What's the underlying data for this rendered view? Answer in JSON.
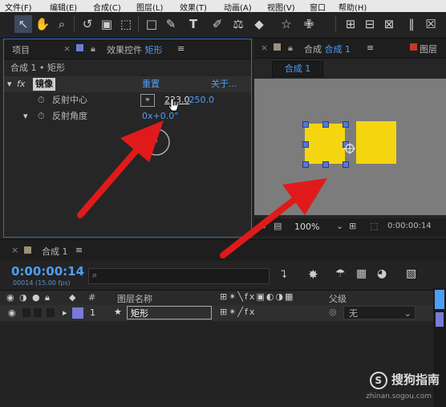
{
  "menu": [
    "文件(F)",
    "编辑(E)",
    "合成(C)",
    "图层(L)",
    "效果(T)",
    "动画(A)",
    "视图(V)",
    "窗口",
    "帮助(H)"
  ],
  "tools": [
    "selection-icon",
    "hand-icon",
    "zoom-icon",
    "rotate-icon",
    "camera-icon",
    "pan-behind-icon",
    "rectangle-icon",
    "pen-icon",
    "type-icon",
    "brush-icon",
    "clone-stamp-icon",
    "eraser-icon",
    "roto-brush-icon",
    "puppet-pin-icon"
  ],
  "left_panel": {
    "tab_project": "项目",
    "tab_effects_prefix": "效果控件",
    "tab_effects_layer": "矩形",
    "breadcrumb": "合成 1 • 矩形",
    "effect_name": "镜像",
    "reset_label": "重置",
    "about_label": "关于...",
    "prop1_label": "反射中心",
    "prop1_x": "223.0",
    "prop1_y": ",250.0",
    "prop2_label": "反射角度",
    "prop2_value": "0x+0.0°"
  },
  "right_panel": {
    "tab_prefix": "合成",
    "tab_comp": "合成 1",
    "tab_layer": "图层",
    "subtab": "合成 1",
    "zoom": "100%",
    "timecode": "0:00:00:14"
  },
  "timeline": {
    "tab_label": "合成 1",
    "timecode": "0:00:00:14",
    "frames": "00014 (15.00 fps)",
    "search_placeholder": "",
    "col_hash": "#",
    "col_layer_name": "图层名称",
    "col_parent": "父级",
    "layer_number": "1",
    "layer_name": "矩形",
    "parent_value": "无"
  },
  "watermark": {
    "logo": "S",
    "text": "搜狗指南",
    "sub": "zhinan.sogou.com"
  },
  "colors": {
    "accent_blue": "#4d9ef5",
    "arrow_red": "#e01a1a",
    "shape_yellow": "#f5d510",
    "label_purple": "#7a7ad8"
  }
}
